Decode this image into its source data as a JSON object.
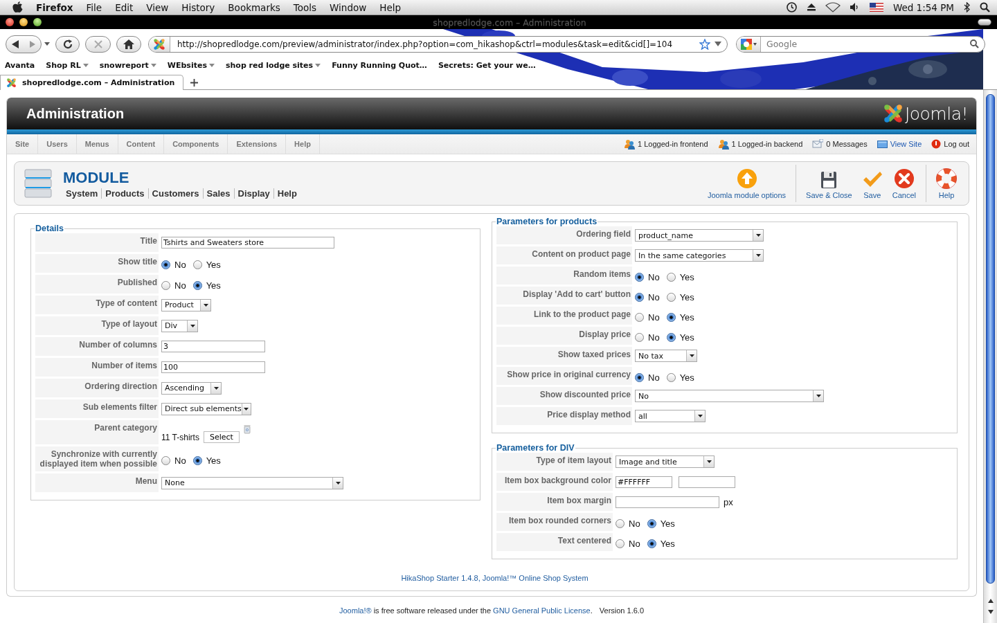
{
  "menubar": {
    "app": "Firefox",
    "menus": [
      "File",
      "Edit",
      "View",
      "History",
      "Bookmarks",
      "Tools",
      "Window",
      "Help"
    ],
    "clock": "Wed 1:54 PM"
  },
  "window": {
    "title": "shopredlodge.com – Administration"
  },
  "navbar": {
    "url": "http://shopredlodge.com/preview/administrator/index.php?option=com_hikashop&ctrl=modules&task=edit&cid[]=104",
    "search_placeholder": "Google"
  },
  "bookmarks": [
    {
      "label": "Avanta",
      "dropdown": false
    },
    {
      "label": "Shop RL",
      "dropdown": true
    },
    {
      "label": "snowreport",
      "dropdown": true
    },
    {
      "label": "WEbsites",
      "dropdown": true
    },
    {
      "label": "shop red lodge sites",
      "dropdown": true
    },
    {
      "label": "Funny Running Quot…",
      "dropdown": false
    },
    {
      "label": "Secrets: Get your we…",
      "dropdown": false
    }
  ],
  "tabs": [
    {
      "label": "shopredlodge.com – Administration",
      "selected": true
    }
  ],
  "admin": {
    "title": "Administration",
    "logo": "Joomla!",
    "menu": [
      "Site",
      "Users",
      "Menus",
      "Content",
      "Components",
      "Extensions",
      "Help"
    ],
    "status": [
      {
        "kind": "users",
        "text": "1 Logged-in frontend",
        "link": false
      },
      {
        "kind": "users",
        "text": "1 Logged-in backend",
        "link": false
      },
      {
        "kind": "messages",
        "text": "0 Messages",
        "link": false
      },
      {
        "kind": "site",
        "text": "View Site",
        "link": true
      },
      {
        "kind": "logout",
        "text": "Log out",
        "link": false
      }
    ]
  },
  "module": {
    "title": "MODULE",
    "submenu": [
      "System",
      "Products",
      "Customers",
      "Sales",
      "Display",
      "Help"
    ],
    "toolbar": [
      {
        "kind": "options",
        "label": "Joomla module options"
      },
      {
        "kind": "save_close",
        "label": "Save & Close"
      },
      {
        "kind": "save",
        "label": "Save"
      },
      {
        "kind": "cancel",
        "label": "Cancel"
      },
      {
        "kind": "help",
        "label": "Help"
      }
    ]
  },
  "details": {
    "legend": "Details",
    "rows": [
      {
        "kind": "text",
        "label": "Title",
        "value": "Tshirts and Sweaters store"
      },
      {
        "kind": "radio",
        "label": "Show title",
        "options": [
          {
            "label": "No",
            "selected": true
          },
          {
            "label": "Yes",
            "selected": false
          }
        ]
      },
      {
        "kind": "radio",
        "label": "Published",
        "options": [
          {
            "label": "No",
            "selected": false
          },
          {
            "label": "Yes",
            "selected": true
          }
        ]
      },
      {
        "kind": "select",
        "label": "Type of content",
        "value": "Product"
      },
      {
        "kind": "select",
        "label": "Type of layout",
        "value": "Div"
      },
      {
        "kind": "text",
        "label": "Number of columns",
        "value": "3"
      },
      {
        "kind": "text",
        "label": "Number of items",
        "value": "100"
      },
      {
        "kind": "select",
        "label": "Ordering direction",
        "value": "Ascending"
      },
      {
        "kind": "select",
        "label": "Sub elements filter",
        "value": "Direct sub elements"
      },
      {
        "kind": "category",
        "label": "Parent category",
        "value": "11 T-shirts",
        "button": "Select"
      },
      {
        "kind": "radio",
        "label": "Synchronize with currently displayed item when possible",
        "options": [
          {
            "label": "No",
            "selected": false
          },
          {
            "label": "Yes",
            "selected": true
          }
        ]
      },
      {
        "kind": "select",
        "label": "Menu",
        "value": "None"
      }
    ]
  },
  "products": {
    "legend": "Parameters for products",
    "rows": [
      {
        "kind": "select",
        "label": "Ordering field",
        "value": "product_name"
      },
      {
        "kind": "select",
        "label": "Content on product page",
        "value": "In the same categories"
      },
      {
        "kind": "radio",
        "label": "Random items",
        "options": [
          {
            "label": "No",
            "selected": true
          },
          {
            "label": "Yes",
            "selected": false
          }
        ]
      },
      {
        "kind": "radio",
        "label": "Display 'Add to cart' button",
        "options": [
          {
            "label": "No",
            "selected": true
          },
          {
            "label": "Yes",
            "selected": false
          }
        ]
      },
      {
        "kind": "radio",
        "label": "Link to the product page",
        "options": [
          {
            "label": "No",
            "selected": false
          },
          {
            "label": "Yes",
            "selected": true
          }
        ]
      },
      {
        "kind": "radio",
        "label": "Display price",
        "options": [
          {
            "label": "No",
            "selected": false
          },
          {
            "label": "Yes",
            "selected": true
          }
        ]
      },
      {
        "kind": "select",
        "label": "Show taxed prices",
        "value": "No tax"
      },
      {
        "kind": "radio",
        "label": "Show price in original currency",
        "options": [
          {
            "label": "No",
            "selected": true
          },
          {
            "label": "Yes",
            "selected": false
          }
        ]
      },
      {
        "kind": "select",
        "label": "Show discounted price",
        "value": "No"
      },
      {
        "kind": "select",
        "label": "Price display method",
        "value": "all"
      }
    ]
  },
  "div": {
    "legend": "Parameters for DIV",
    "rows": [
      {
        "kind": "select",
        "label": "Type of item layout",
        "value": "Image and title"
      },
      {
        "kind": "color",
        "label": "Item box background color",
        "value": "#FFFFFF"
      },
      {
        "kind": "margin",
        "label": "Item box margin",
        "unit": "px"
      },
      {
        "kind": "radio",
        "label": "Item box rounded corners",
        "options": [
          {
            "label": "No",
            "selected": false
          },
          {
            "label": "Yes",
            "selected": true
          }
        ]
      },
      {
        "kind": "radio",
        "label": "Text centered",
        "options": [
          {
            "label": "No",
            "selected": false
          },
          {
            "label": "Yes",
            "selected": true
          }
        ]
      }
    ]
  },
  "credits": "HikaShop Starter 1.4.8, Joomla!™ Online Shop System",
  "footer": {
    "parts": [
      {
        "text": "Joomla!®",
        "link": true
      },
      {
        "text": " is free software released under the ",
        "link": false
      },
      {
        "text": "GNU General Public License",
        "link": true
      },
      {
        "text": ".",
        "link": false
      }
    ],
    "version": "Version 1.6.0"
  }
}
